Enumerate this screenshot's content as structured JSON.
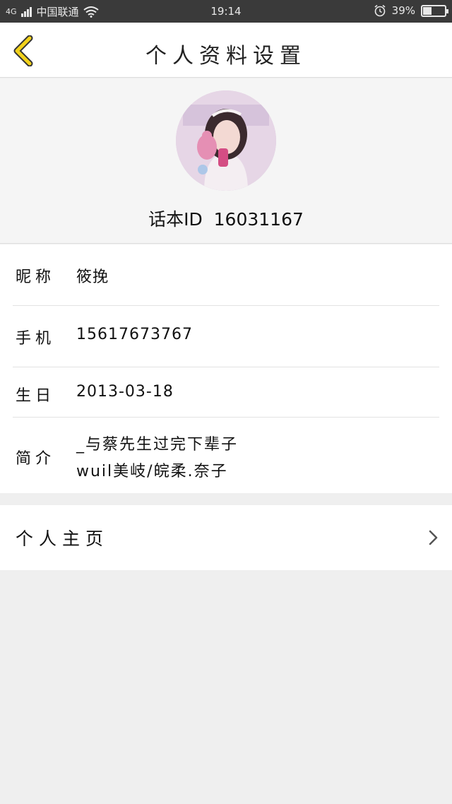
{
  "status_bar": {
    "signal": "4G",
    "carrier": "中国联通",
    "time": "19:14",
    "battery": "39%",
    "battery_level": 0.39,
    "icons": [
      "signal-icon",
      "wifi-icon",
      "alarm-icon",
      "battery-icon"
    ]
  },
  "navbar": {
    "title": "个人资料设置",
    "back_icon": "chevron-left-icon",
    "accent_color": "#f2d21b"
  },
  "profile": {
    "id_label": "话本ID",
    "id_value": "16031167"
  },
  "fields": {
    "nickname": {
      "label": "昵称",
      "value": "筱挽"
    },
    "phone": {
      "label": "手机",
      "value": "15617673767"
    },
    "birthday": {
      "label": "生日",
      "value": "2013-03-18"
    },
    "bio": {
      "label": "简介",
      "line1": "_与蔡先生过完下辈子",
      "line2": "wuil美岐/皖柔.奈子"
    }
  },
  "homepage": {
    "label": "个人主页",
    "chevron_icon": "chevron-right-icon"
  }
}
